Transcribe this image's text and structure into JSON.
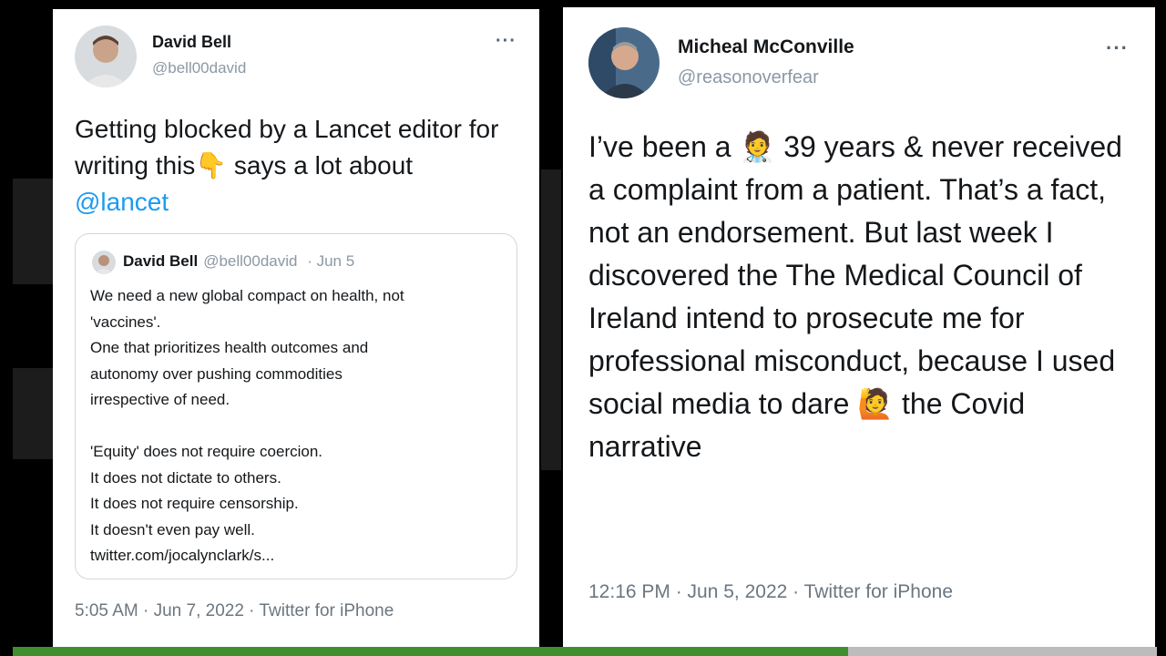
{
  "left_tweet": {
    "author_name": "David Bell",
    "author_handle": "@bell00david",
    "more_icon": "more-horizontal-icon",
    "text_part1": "Getting blocked by a Lancet editor for writing this",
    "emoji_pointing_down": "👇",
    "text_part2": " says a lot about ",
    "mention": "@lancet",
    "quoted_tweet": {
      "author_name": "David Bell",
      "author_handle": "@bell00david",
      "date": "· Jun 5",
      "lines": [
        "We need a new global compact on health, not",
        "'vaccines'.",
        "One that prioritizes health outcomes and",
        "autonomy over pushing commodities",
        "irrespective of need.",
        "",
        "'Equity' does not require coercion.",
        "It does not dictate to others.",
        "It does not require censorship.",
        "It doesn't even pay well.",
        "twitter.com/jocalynclark/s..."
      ]
    },
    "timestamp": "5:05 AM · Jun 7, 2022 · Twitter for iPhone"
  },
  "right_tweet": {
    "author_name": "Micheal McConville",
    "author_handle": "@reasonoverfear",
    "more_icon": "more-horizontal-icon",
    "text_part1": "I’ve been a ",
    "emoji_doctor": "🧑‍⚕️",
    "text_part2": " 39 years & never received a complaint from a patient. That’s a fact, not an endorsement. But last week I discovered the The Medical Council of Ireland intend to prosecute me for professional misconduct, because I used social media to dare ",
    "emoji_question": "🙋",
    "text_part3": " the Covid narrative",
    "timestamp": "12:16 PM · Jun 5, 2022 · Twitter for iPhone"
  },
  "video_progress": {
    "fraction": 0.73
  },
  "colors": {
    "mention": "#1d9bf0",
    "progress": "#3f8f2f"
  }
}
